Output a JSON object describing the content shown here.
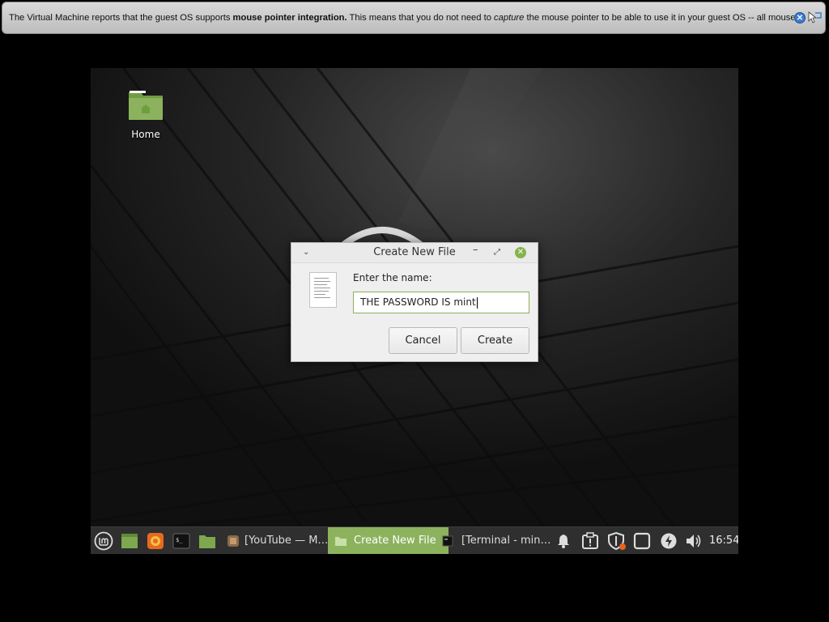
{
  "vm_notice": {
    "part1": "The Virtual Machine reports that the guest OS supports ",
    "bold": "mouse pointer integration.",
    "part2": " This means that you do not need to ",
    "italic": "capture",
    "part3": " the mouse pointer to be able to use it in your guest OS -- all mouse",
    "close_icon": "close-icon",
    "mouse_icon": "mouse-integration-icon"
  },
  "desktop": {
    "icons": [
      {
        "label": "Home",
        "icon": "folder-home-icon"
      }
    ]
  },
  "dialog": {
    "title": "Create New File",
    "prompt": "Enter the name:",
    "filename_value": "THE PASSWORD IS mint",
    "cancel_label": "Cancel",
    "create_label": "Create"
  },
  "taskbar": {
    "launchers": [
      "mint-menu-icon",
      "show-desktop-icon",
      "firefox-icon",
      "terminal-icon",
      "files-icon"
    ],
    "tasks": [
      {
        "label": "[YouTube — M…",
        "icon": "firefox-window-icon",
        "active": false
      },
      {
        "label": "Create New File",
        "icon": "folder-window-icon",
        "active": true
      },
      {
        "label": "[Terminal - min…",
        "icon": "terminal-window-icon",
        "active": false
      }
    ],
    "tray": [
      "notifications-icon",
      "update-manager-icon",
      "shield-icon",
      "workspace-icon",
      "power-icon",
      "volume-icon"
    ],
    "clock": "16:54"
  },
  "colors": {
    "accent": "#8cb25e",
    "taskbar_bg": "#2f2f2f",
    "notice_bg": "#cfcfcf"
  }
}
